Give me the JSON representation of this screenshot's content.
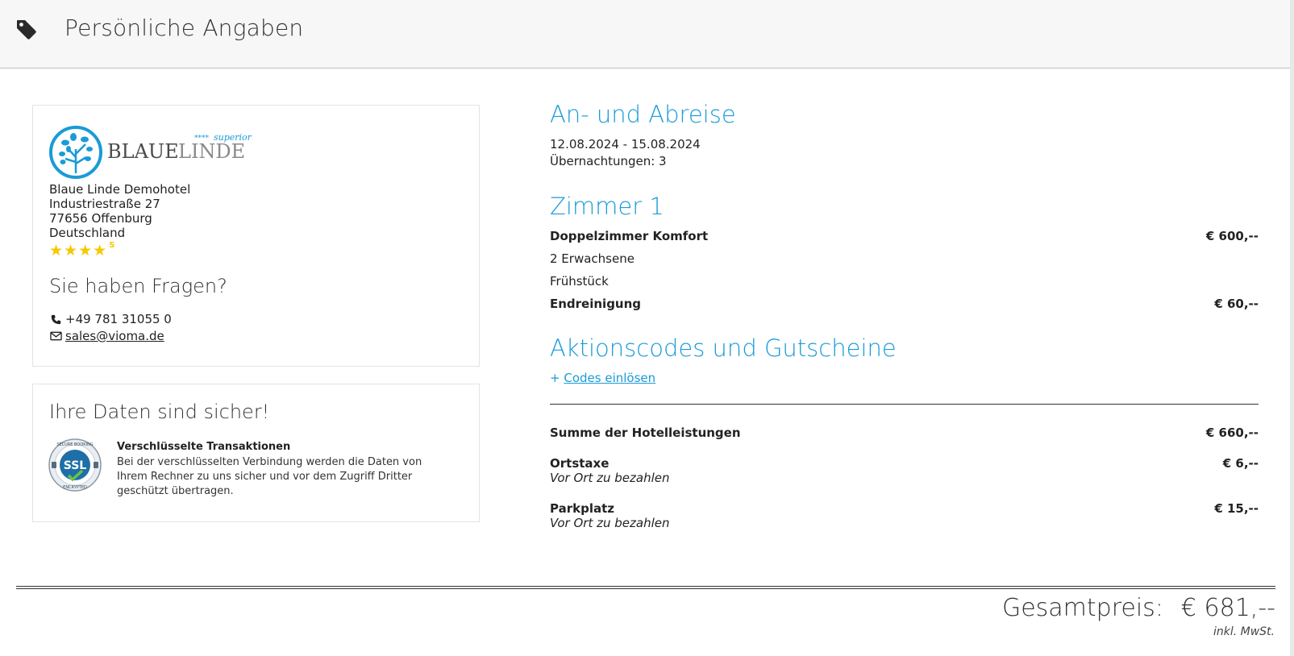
{
  "header": {
    "title": "Persönliche Angaben",
    "icon": "tag-icon"
  },
  "hotel": {
    "logo": {
      "brand_a": "BLAUE",
      "brand_b": "LINDE",
      "stars_text": "****",
      "superior_text": "superior"
    },
    "name": "Blaue Linde Demohotel",
    "street": "Industriestraße 27",
    "city": "77656 Offenburg",
    "country": "Deutschland",
    "rating": 4,
    "rating_suffix": "S",
    "faq_title": "Sie haben Fragen?",
    "phone": "+49 781 31055 0",
    "email": "sales@vioma.de"
  },
  "security": {
    "title": "Ihre Daten sind sicher!",
    "badge": {
      "top": "SECURE BOOKING",
      "middle": "SSL",
      "bottom": "ENCRYPTED"
    },
    "heading": "Verschlüsselte Transaktionen",
    "text": "Bei der verschlüsselten Verbindung werden die Daten von Ihrem Rechner zu uns sicher und vor dem Zugriff Dritter geschützt übertragen."
  },
  "stay": {
    "title": "An- und Abreise",
    "dates": "12.08.2024 - 15.08.2024",
    "nights": "Übernachtungen: 3"
  },
  "room": {
    "title": "Zimmer 1",
    "type": "Doppelzimmer Komfort",
    "type_price": "€ 600,--",
    "guests": "2 Erwachsene",
    "board": "Frühstück",
    "cleaning": "Endreinigung",
    "cleaning_price": "€ 60,--"
  },
  "codes": {
    "title": "Aktionscodes und Gutscheine",
    "prefix": "+",
    "link": "Codes einlösen"
  },
  "summary": {
    "hotel_sum_label": "Summe der Hotelleistungen",
    "hotel_sum_price": "€ 660,--",
    "tax_label": "Ortstaxe",
    "tax_price": "€ 6,--",
    "tax_note": "Vor Ort zu bezahlen",
    "parking_label": "Parkplatz",
    "parking_price": "€ 15,--",
    "parking_note": "Vor Ort zu bezahlen"
  },
  "total": {
    "label": "Gesamtpreis:",
    "price": "€ 681,--",
    "note": "inkl. MwSt."
  },
  "colors": {
    "accent": "#1a9bd7",
    "star": "#f5c800",
    "header_bg": "#f7f7f7"
  }
}
